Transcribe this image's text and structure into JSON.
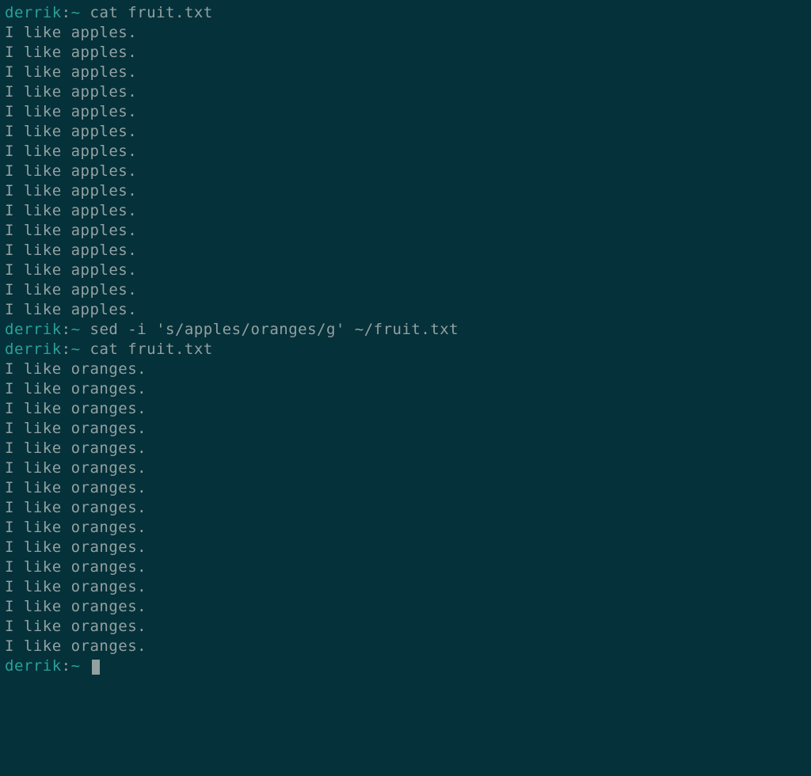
{
  "prompt": {
    "user": "derrik",
    "sep1": ":",
    "path": "~",
    "sep2": " "
  },
  "blocks": [
    {
      "type": "cmd",
      "command": "cat fruit.txt"
    },
    {
      "type": "out",
      "text": "I like apples.",
      "repeat": 15
    },
    {
      "type": "cmd",
      "command": "sed -i 's/apples/oranges/g' ~/fruit.txt"
    },
    {
      "type": "cmd",
      "command": "cat fruit.txt"
    },
    {
      "type": "out",
      "text": "I like oranges.",
      "repeat": 15
    },
    {
      "type": "cursor"
    }
  ]
}
